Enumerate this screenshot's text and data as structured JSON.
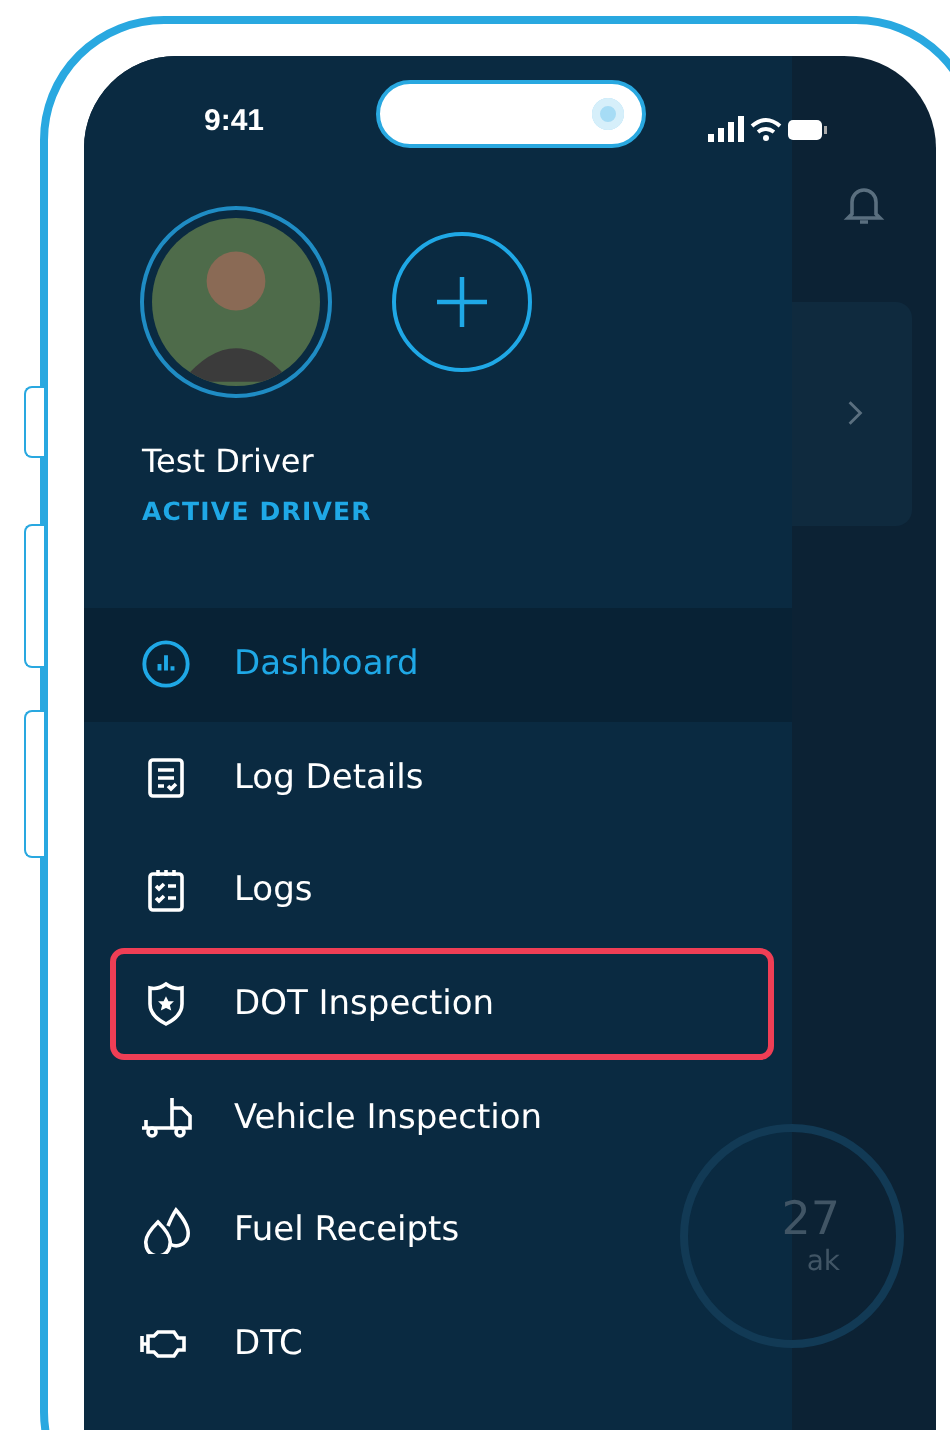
{
  "status_bar": {
    "time": "9:41"
  },
  "profile": {
    "name": "Test Driver",
    "role": "ACTIVE DRIVER"
  },
  "menu": [
    {
      "label": "Dashboard",
      "kind": "chart",
      "selected": true,
      "highlighted": false
    },
    {
      "label": "Log Details",
      "kind": "document",
      "selected": false,
      "highlighted": false
    },
    {
      "label": "Logs",
      "kind": "checklist",
      "selected": false,
      "highlighted": false
    },
    {
      "label": "DOT Inspection",
      "kind": "shield",
      "selected": false,
      "highlighted": true
    },
    {
      "label": "Vehicle Inspection",
      "kind": "truck",
      "selected": false,
      "highlighted": false
    },
    {
      "label": "Fuel Receipts",
      "kind": "drops",
      "selected": false,
      "highlighted": false
    },
    {
      "label": "DTC",
      "kind": "engine",
      "selected": false,
      "highlighted": false
    }
  ],
  "background_screen": {
    "gauge_value": "27",
    "gauge_label": "ak"
  }
}
